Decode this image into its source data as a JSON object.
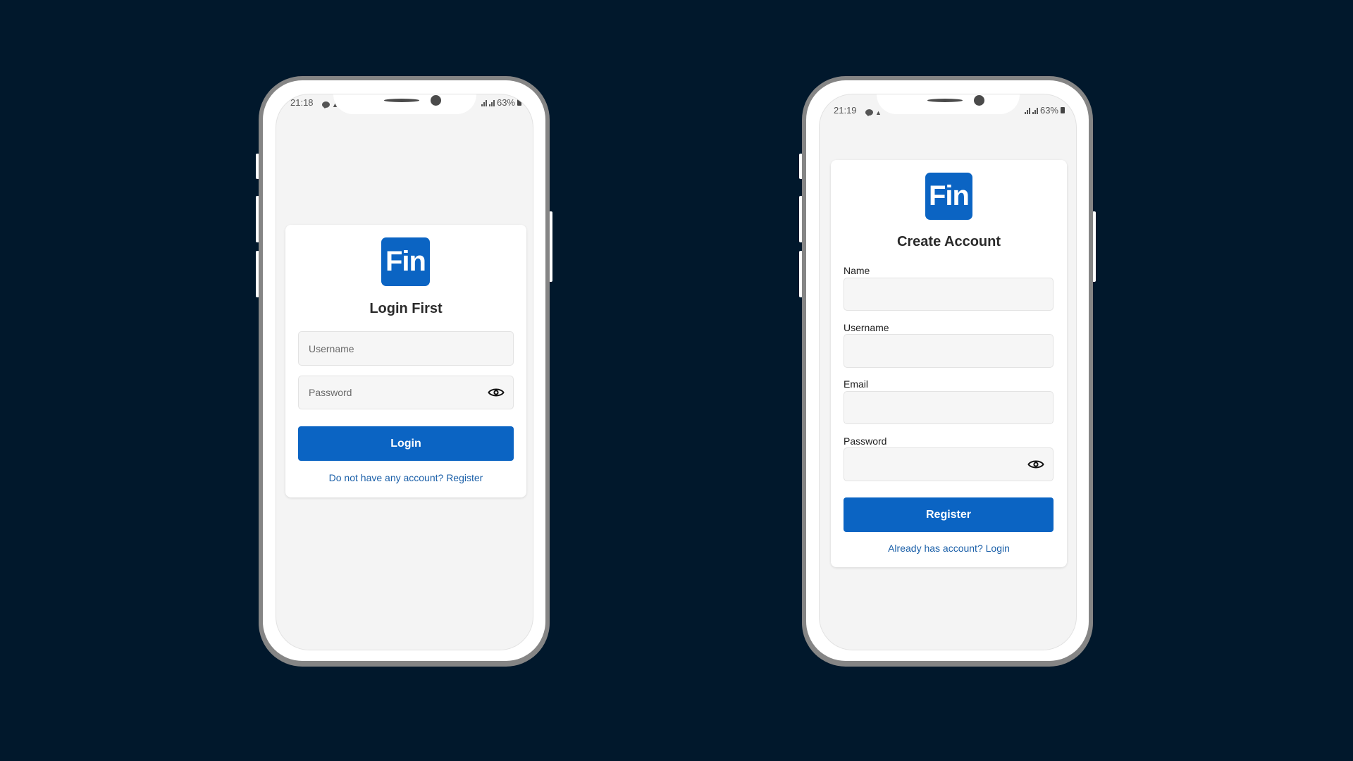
{
  "colors": {
    "background": "#01182c",
    "brand": "#0b64c3",
    "link": "#1a5fa8"
  },
  "login_screen": {
    "status_bar": {
      "time": "21:18",
      "notification_icons": [
        "line-message-icon",
        "notification-icon"
      ],
      "battery": "63%"
    },
    "logo_text": "Fin",
    "title": "Login First",
    "username": {
      "placeholder": "Username",
      "value": ""
    },
    "password": {
      "placeholder": "Password",
      "value": "",
      "toggle_icon": "eye-icon"
    },
    "submit_label": "Login",
    "register_link": "Do not have any account? Register"
  },
  "register_screen": {
    "status_bar": {
      "time": "21:19",
      "notification_icons": [
        "line-message-icon",
        "notification-icon"
      ],
      "battery": "63%"
    },
    "logo_text": "Fin",
    "title": "Create Account",
    "fields": [
      {
        "label": "Name",
        "value": ""
      },
      {
        "label": "Username",
        "value": ""
      },
      {
        "label": "Email",
        "value": ""
      },
      {
        "label": "Password",
        "value": "",
        "toggle_icon": "eye-icon"
      }
    ],
    "submit_label": "Register",
    "login_link": "Already has account? Login"
  }
}
